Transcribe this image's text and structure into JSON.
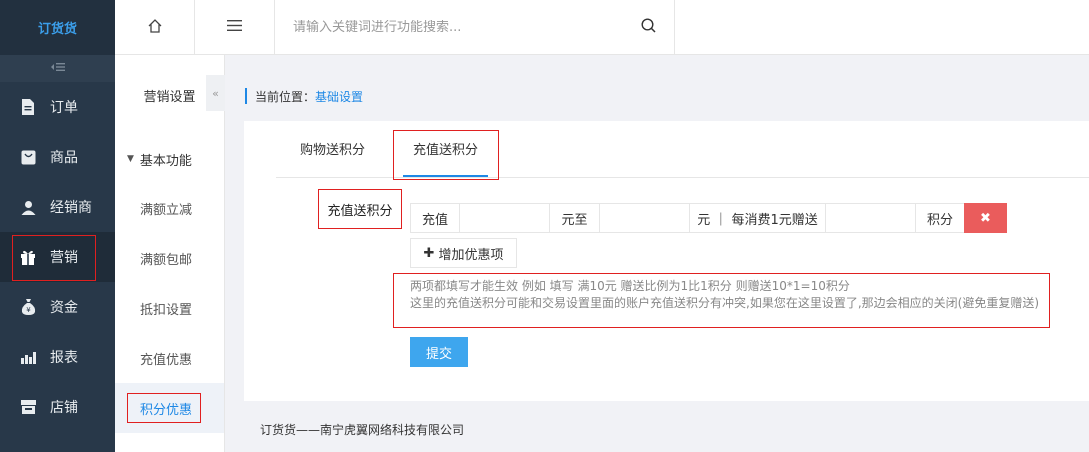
{
  "logo": {
    "text": "订货货"
  },
  "sidebar": {
    "collapse_icon": "collapse-left-icon",
    "items": [
      {
        "label": "订单",
        "icon": "file-icon"
      },
      {
        "label": "商品",
        "icon": "bag-icon"
      },
      {
        "label": "经销商",
        "icon": "user-icon"
      },
      {
        "label": "营销",
        "icon": "gift-icon",
        "active": true
      },
      {
        "label": "资金",
        "icon": "money-bag-icon"
      },
      {
        "label": "报表",
        "icon": "bar-chart-icon"
      },
      {
        "label": "店铺",
        "icon": "store-icon"
      }
    ]
  },
  "topbar": {
    "home_icon": "home-icon",
    "menu_icon": "hamburger-icon",
    "search_placeholder": "请输入关键词进行功能搜索...",
    "search_icon": "search-icon"
  },
  "subnav": {
    "title": "营销设置",
    "group": "基本功能",
    "items": [
      {
        "label": "满额立减"
      },
      {
        "label": "满额包邮"
      },
      {
        "label": "抵扣设置"
      },
      {
        "label": "充值优惠"
      },
      {
        "label": "积分优惠",
        "active": true
      }
    ]
  },
  "breadcrumb": {
    "prefix": "当前位置：",
    "current": "基础设置"
  },
  "tabs": [
    {
      "label": "购物送积分"
    },
    {
      "label": "充值送积分",
      "active": true
    }
  ],
  "form": {
    "field_label": "充值送积分",
    "recharge_label": "充值",
    "yuan_to_label": "元至",
    "yuan_every_label": "元 ｜ 每消费1元赠送",
    "points_label": "积分",
    "delete_icon": "close-icon",
    "add_button": "增加优惠项",
    "note_line1": "两项都填写才能生效 例如 填写 满10元 赠送比例为1比1积分 则赠送10*1=10积分",
    "note_line2": "这里的充值送积分可能和交易设置里面的账户充值送积分有冲突,如果您在这里设置了,那边会相应的关闭(避免重复赠送)",
    "submit": "提交"
  },
  "footer": {
    "text": "订货货——南宁虎翼网络科技有限公司"
  },
  "colors": {
    "sidebar_bg": "#283849",
    "accent": "#1e88e5",
    "danger": "#ea5c5c",
    "highlight_box": "#e02020"
  }
}
